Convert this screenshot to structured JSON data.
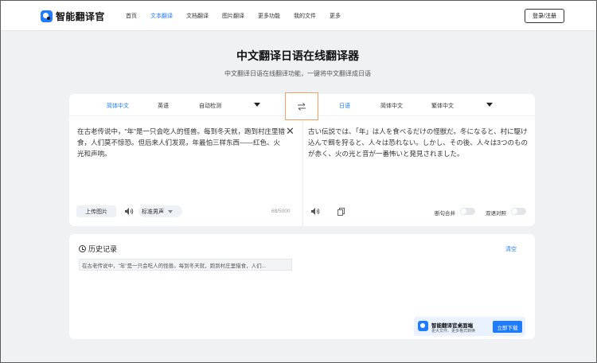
{
  "app": {
    "name": "智能翻译官"
  },
  "nav": {
    "items": [
      "首页",
      "文本翻译",
      "文档翻译",
      "图片翻译",
      "更多功能",
      "我的文件",
      "更多"
    ],
    "active_index": 1,
    "login_label": "登录/注册"
  },
  "header": {
    "title": "中文翻译日语在线翻译器",
    "subtitle": "中文翻译日语在线翻译功能，一键将中文翻译成日语"
  },
  "translator": {
    "source_langs": [
      "简体中文",
      "英语",
      "自动检测"
    ],
    "target_langs": [
      "日语",
      "简体中文",
      "繁体中文"
    ],
    "source_text": "在古老传说中，\"年\"是一只会吃人的怪兽。每到冬天就，跑到村庄里猎食，人们莫不惊恐。但后来人们发现，年最怕三样东西——红色、火光和声响。",
    "target_text": "古い伝説では、「年」は人を食べるだけの怪獣だ。冬になると、村に駆け込んで餌を狩ると、人々は恐れない。しかし、その後、人々は3つのものが赤く、火の光と音が一番怖いと発見されました。",
    "upload_label": "上传图片",
    "voice_label": "标准男声",
    "char_count": "68/5000",
    "sentence_merge_label": "断句合并",
    "bilingual_label": "双语对照",
    "accent_color": "#1f7bff",
    "swap_highlight_color": "#f0a060"
  },
  "history": {
    "title": "历史记录",
    "clear_label": "清空",
    "items": [
      "在古老传说中，\"年\"是一只会吃人的怪兽。每到冬天就，跑到村庄里猎食，人们..."
    ]
  },
  "promo": {
    "title": "智能翻译官桌面端",
    "subtitle": "更大文件、更多格式转换",
    "button_label": "立即下载"
  }
}
